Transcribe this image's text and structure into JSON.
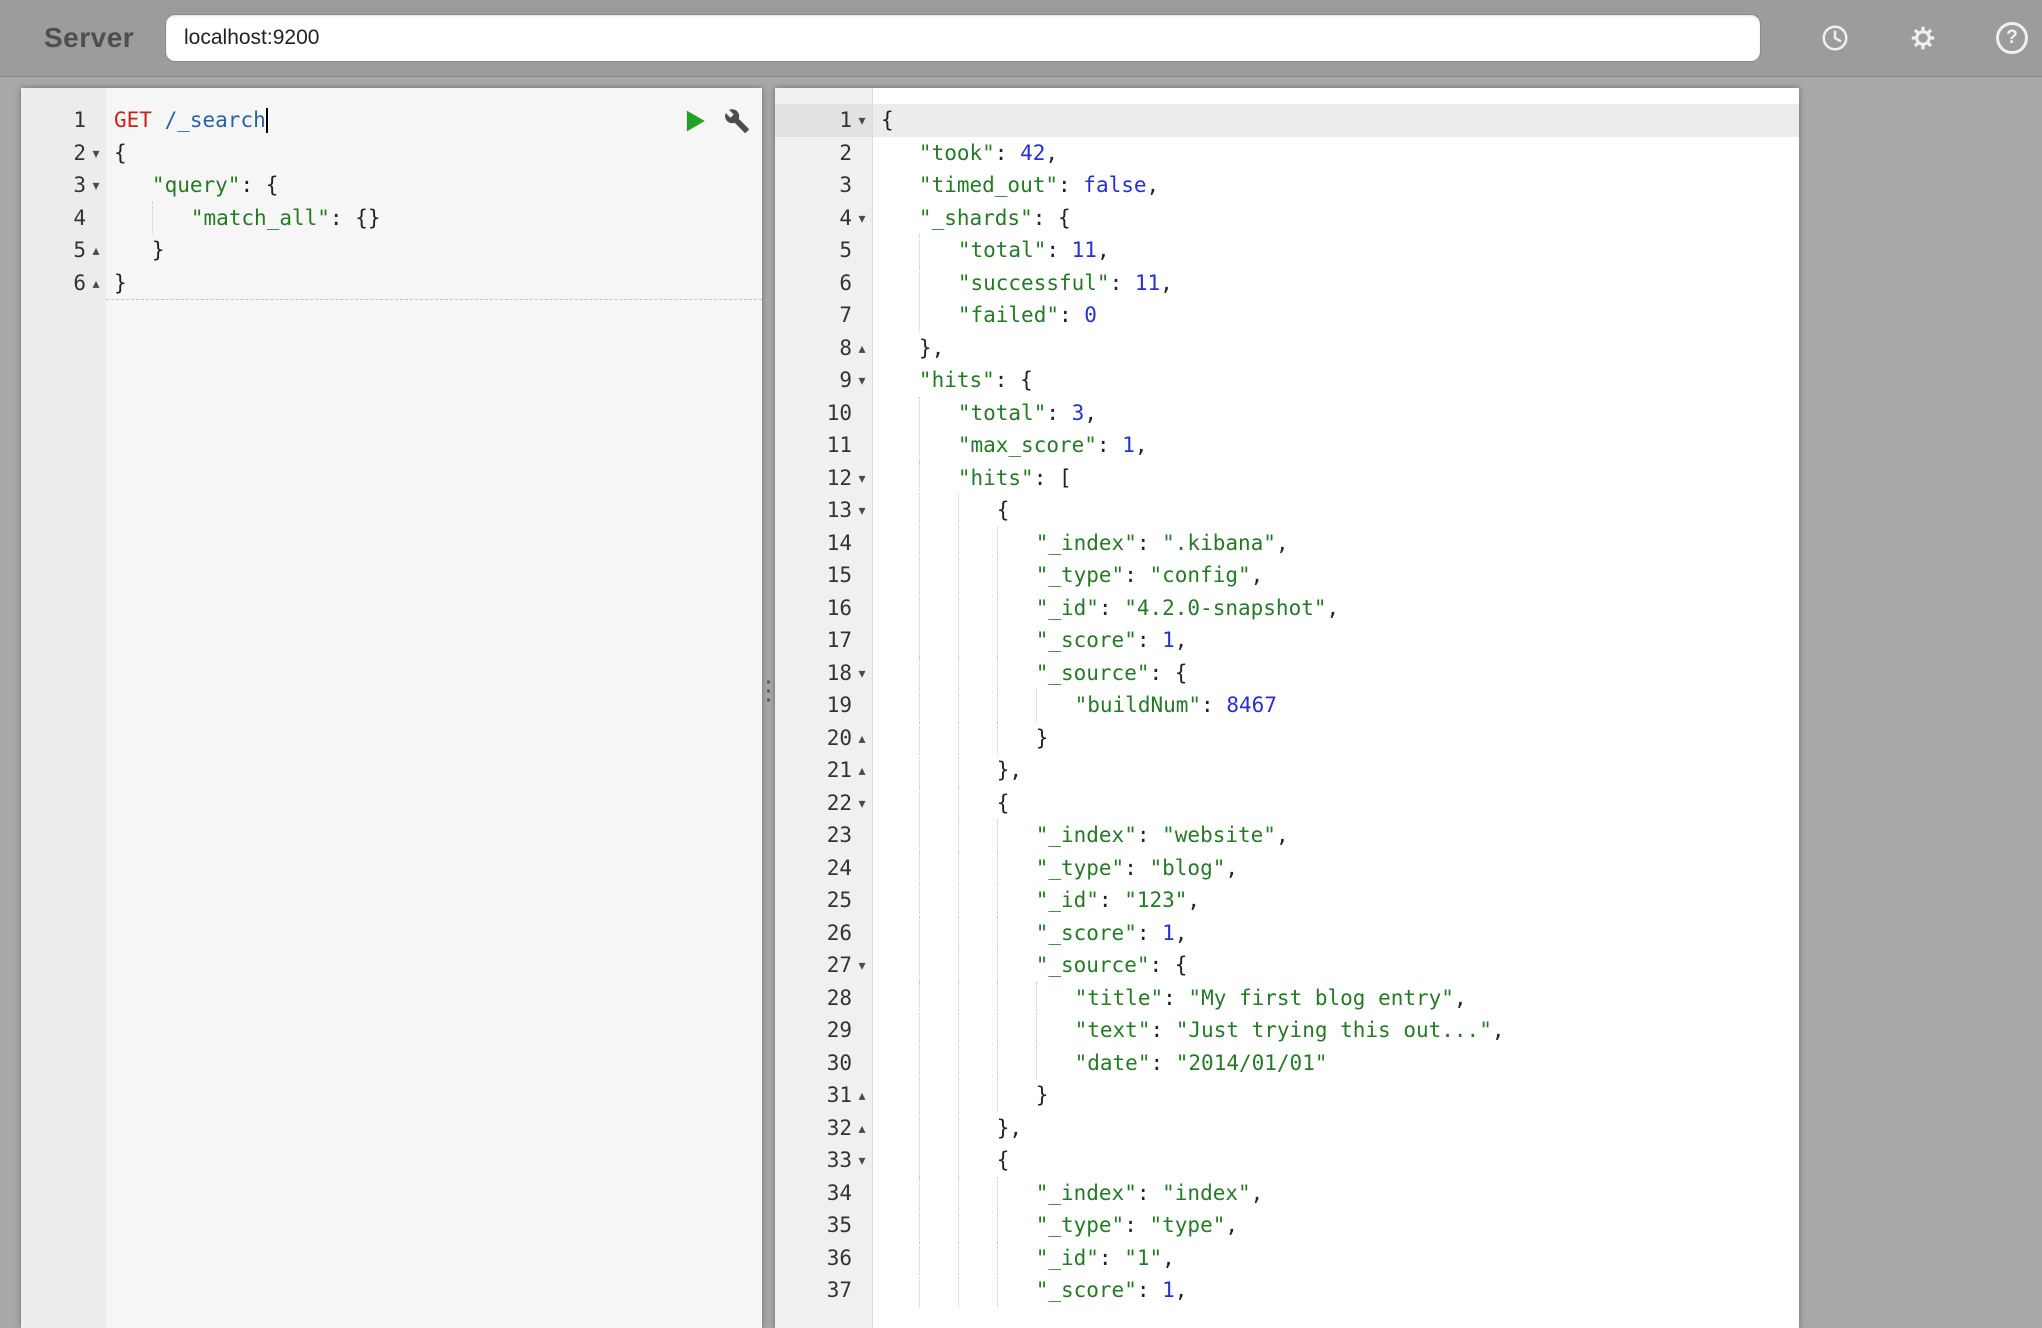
{
  "topbar": {
    "label": "Server",
    "server_input": "localhost:9200",
    "help_glyph": "?",
    "icon_names": [
      "history-icon",
      "gear-icon",
      "help-icon"
    ]
  },
  "colors": {
    "page_bg": "#a8a8a8",
    "topbar_bg": "#9c9c9c",
    "request_bg": "#f6f6f6",
    "response_bg": "#ffffff",
    "json_key": "#257a25",
    "json_string": "#257a25",
    "json_number": "#2430d6",
    "json_boolean": "#2430d6",
    "http_method": "#cb2217",
    "url": "#2962a8",
    "send_button": "#23a127"
  },
  "glyphs": {
    "fold_down": "▾",
    "fold_up": "▴"
  },
  "splitter": {
    "handle_glyph": "⋮"
  },
  "request_editor": {
    "lines": [
      {
        "n": 1,
        "ind": 0,
        "fold": "",
        "cur": true,
        "tokens": [
          [
            "method",
            "GET"
          ],
          [
            "plain",
            " "
          ],
          [
            "url",
            "/_search"
          ]
        ]
      },
      {
        "n": 2,
        "ind": 0,
        "fold": "down",
        "tokens": [
          [
            "plain",
            "{"
          ]
        ]
      },
      {
        "n": 3,
        "ind": 3,
        "fold": "down",
        "tokens": [
          [
            "key",
            "\"query\""
          ],
          [
            "plain",
            ": {"
          ]
        ]
      },
      {
        "n": 4,
        "ind": 6,
        "fold": "",
        "tokens": [
          [
            "key",
            "\"match_all\""
          ],
          [
            "plain",
            ": {}"
          ]
        ]
      },
      {
        "n": 5,
        "ind": 3,
        "fold": "up",
        "tokens": [
          [
            "plain",
            "}"
          ]
        ]
      },
      {
        "n": 6,
        "ind": 0,
        "fold": "up",
        "tokens": [
          [
            "plain",
            "}"
          ]
        ]
      }
    ]
  },
  "response_viewer": {
    "lines": [
      {
        "n": 1,
        "ind": 0,
        "fold": "down",
        "act": true,
        "tokens": [
          [
            "plain",
            "{"
          ]
        ]
      },
      {
        "n": 2,
        "ind": 3,
        "fold": "",
        "tokens": [
          [
            "key",
            "\"took\""
          ],
          [
            "plain",
            ": "
          ],
          [
            "num",
            "42"
          ],
          [
            "plain",
            ","
          ]
        ]
      },
      {
        "n": 3,
        "ind": 3,
        "fold": "",
        "tokens": [
          [
            "key",
            "\"timed_out\""
          ],
          [
            "plain",
            ": "
          ],
          [
            "bool",
            "false"
          ],
          [
            "plain",
            ","
          ]
        ]
      },
      {
        "n": 4,
        "ind": 3,
        "fold": "down",
        "tokens": [
          [
            "key",
            "\"_shards\""
          ],
          [
            "plain",
            ": {"
          ]
        ]
      },
      {
        "n": 5,
        "ind": 6,
        "fold": "",
        "tokens": [
          [
            "key",
            "\"total\""
          ],
          [
            "plain",
            ": "
          ],
          [
            "num",
            "11"
          ],
          [
            "plain",
            ","
          ]
        ]
      },
      {
        "n": 6,
        "ind": 6,
        "fold": "",
        "tokens": [
          [
            "key",
            "\"successful\""
          ],
          [
            "plain",
            ": "
          ],
          [
            "num",
            "11"
          ],
          [
            "plain",
            ","
          ]
        ]
      },
      {
        "n": 7,
        "ind": 6,
        "fold": "",
        "tokens": [
          [
            "key",
            "\"failed\""
          ],
          [
            "plain",
            ": "
          ],
          [
            "num",
            "0"
          ]
        ]
      },
      {
        "n": 8,
        "ind": 3,
        "fold": "up",
        "tokens": [
          [
            "plain",
            "},"
          ]
        ]
      },
      {
        "n": 9,
        "ind": 3,
        "fold": "down",
        "tokens": [
          [
            "key",
            "\"hits\""
          ],
          [
            "plain",
            ": {"
          ]
        ]
      },
      {
        "n": 10,
        "ind": 6,
        "fold": "",
        "tokens": [
          [
            "key",
            "\"total\""
          ],
          [
            "plain",
            ": "
          ],
          [
            "num",
            "3"
          ],
          [
            "plain",
            ","
          ]
        ]
      },
      {
        "n": 11,
        "ind": 6,
        "fold": "",
        "tokens": [
          [
            "key",
            "\"max_score\""
          ],
          [
            "plain",
            ": "
          ],
          [
            "num",
            "1"
          ],
          [
            "plain",
            ","
          ]
        ]
      },
      {
        "n": 12,
        "ind": 6,
        "fold": "down",
        "tokens": [
          [
            "key",
            "\"hits\""
          ],
          [
            "plain",
            ": ["
          ]
        ]
      },
      {
        "n": 13,
        "ind": 9,
        "fold": "down",
        "tokens": [
          [
            "plain",
            "{"
          ]
        ]
      },
      {
        "n": 14,
        "ind": 12,
        "fold": "",
        "tokens": [
          [
            "key",
            "\"_index\""
          ],
          [
            "plain",
            ": "
          ],
          [
            "str",
            "\".kibana\""
          ],
          [
            "plain",
            ","
          ]
        ]
      },
      {
        "n": 15,
        "ind": 12,
        "fold": "",
        "tokens": [
          [
            "key",
            "\"_type\""
          ],
          [
            "plain",
            ": "
          ],
          [
            "str",
            "\"config\""
          ],
          [
            "plain",
            ","
          ]
        ]
      },
      {
        "n": 16,
        "ind": 12,
        "fold": "",
        "tokens": [
          [
            "key",
            "\"_id\""
          ],
          [
            "plain",
            ": "
          ],
          [
            "str",
            "\"4.2.0-snapshot\""
          ],
          [
            "plain",
            ","
          ]
        ]
      },
      {
        "n": 17,
        "ind": 12,
        "fold": "",
        "tokens": [
          [
            "key",
            "\"_score\""
          ],
          [
            "plain",
            ": "
          ],
          [
            "num",
            "1"
          ],
          [
            "plain",
            ","
          ]
        ]
      },
      {
        "n": 18,
        "ind": 12,
        "fold": "down",
        "tokens": [
          [
            "key",
            "\"_source\""
          ],
          [
            "plain",
            ": {"
          ]
        ]
      },
      {
        "n": 19,
        "ind": 15,
        "fold": "",
        "tokens": [
          [
            "key",
            "\"buildNum\""
          ],
          [
            "plain",
            ": "
          ],
          [
            "num",
            "8467"
          ]
        ]
      },
      {
        "n": 20,
        "ind": 12,
        "fold": "up",
        "tokens": [
          [
            "plain",
            "}"
          ]
        ]
      },
      {
        "n": 21,
        "ind": 9,
        "fold": "up",
        "tokens": [
          [
            "plain",
            "},"
          ]
        ]
      },
      {
        "n": 22,
        "ind": 9,
        "fold": "down",
        "tokens": [
          [
            "plain",
            "{"
          ]
        ]
      },
      {
        "n": 23,
        "ind": 12,
        "fold": "",
        "tokens": [
          [
            "key",
            "\"_index\""
          ],
          [
            "plain",
            ": "
          ],
          [
            "str",
            "\"website\""
          ],
          [
            "plain",
            ","
          ]
        ]
      },
      {
        "n": 24,
        "ind": 12,
        "fold": "",
        "tokens": [
          [
            "key",
            "\"_type\""
          ],
          [
            "plain",
            ": "
          ],
          [
            "str",
            "\"blog\""
          ],
          [
            "plain",
            ","
          ]
        ]
      },
      {
        "n": 25,
        "ind": 12,
        "fold": "",
        "tokens": [
          [
            "key",
            "\"_id\""
          ],
          [
            "plain",
            ": "
          ],
          [
            "str",
            "\"123\""
          ],
          [
            "plain",
            ","
          ]
        ]
      },
      {
        "n": 26,
        "ind": 12,
        "fold": "",
        "tokens": [
          [
            "key",
            "\"_score\""
          ],
          [
            "plain",
            ": "
          ],
          [
            "num",
            "1"
          ],
          [
            "plain",
            ","
          ]
        ]
      },
      {
        "n": 27,
        "ind": 12,
        "fold": "down",
        "tokens": [
          [
            "key",
            "\"_source\""
          ],
          [
            "plain",
            ": {"
          ]
        ]
      },
      {
        "n": 28,
        "ind": 15,
        "fold": "",
        "tokens": [
          [
            "key",
            "\"title\""
          ],
          [
            "plain",
            ": "
          ],
          [
            "str",
            "\"My first blog entry\""
          ],
          [
            "plain",
            ","
          ]
        ]
      },
      {
        "n": 29,
        "ind": 15,
        "fold": "",
        "tokens": [
          [
            "key",
            "\"text\""
          ],
          [
            "plain",
            ": "
          ],
          [
            "str",
            "\"Just trying this out...\""
          ],
          [
            "plain",
            ","
          ]
        ]
      },
      {
        "n": 30,
        "ind": 15,
        "fold": "",
        "tokens": [
          [
            "key",
            "\"date\""
          ],
          [
            "plain",
            ": "
          ],
          [
            "str",
            "\"2014/01/01\""
          ]
        ]
      },
      {
        "n": 31,
        "ind": 12,
        "fold": "up",
        "tokens": [
          [
            "plain",
            "}"
          ]
        ]
      },
      {
        "n": 32,
        "ind": 9,
        "fold": "up",
        "tokens": [
          [
            "plain",
            "},"
          ]
        ]
      },
      {
        "n": 33,
        "ind": 9,
        "fold": "down",
        "tokens": [
          [
            "plain",
            "{"
          ]
        ]
      },
      {
        "n": 34,
        "ind": 12,
        "fold": "",
        "tokens": [
          [
            "key",
            "\"_index\""
          ],
          [
            "plain",
            ": "
          ],
          [
            "str",
            "\"index\""
          ],
          [
            "plain",
            ","
          ]
        ]
      },
      {
        "n": 35,
        "ind": 12,
        "fold": "",
        "tokens": [
          [
            "key",
            "\"_type\""
          ],
          [
            "plain",
            ": "
          ],
          [
            "str",
            "\"type\""
          ],
          [
            "plain",
            ","
          ]
        ]
      },
      {
        "n": 36,
        "ind": 12,
        "fold": "",
        "tokens": [
          [
            "key",
            "\"_id\""
          ],
          [
            "plain",
            ": "
          ],
          [
            "str",
            "\"1\""
          ],
          [
            "plain",
            ","
          ]
        ]
      },
      {
        "n": 37,
        "ind": 12,
        "fold": "",
        "tokens": [
          [
            "key",
            "\"_score\""
          ],
          [
            "plain",
            ": "
          ],
          [
            "num",
            "1"
          ],
          [
            "plain",
            ","
          ]
        ]
      }
    ]
  }
}
